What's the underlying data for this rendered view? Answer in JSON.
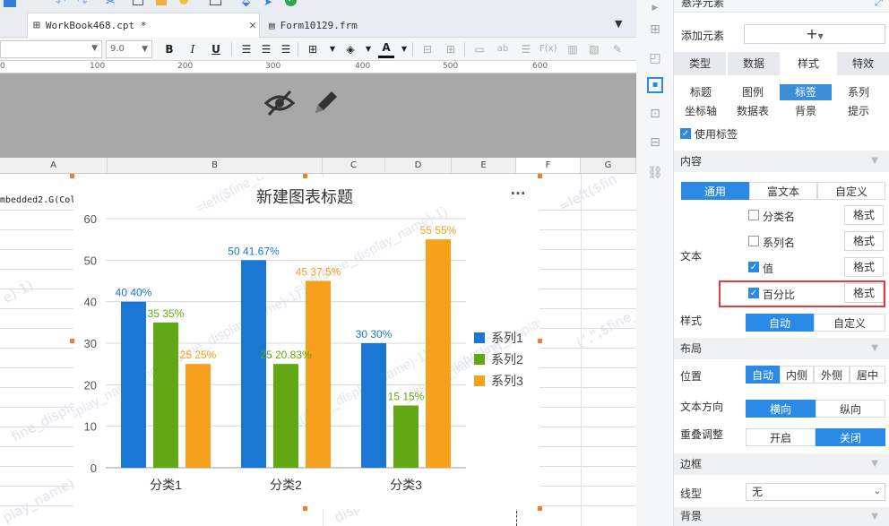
{
  "tabs": [
    {
      "label": "WorkBook468.cpt *"
    },
    {
      "label": "Form10129.frm"
    }
  ],
  "formatbar": {
    "font_size": "9.0",
    "bold": "B",
    "italic": "I",
    "underline": "U"
  },
  "ruler": {
    "ticks": [
      "0",
      "100",
      "200",
      "300",
      "400",
      "500",
      "600"
    ]
  },
  "sheet": {
    "columns": [
      "A",
      "B",
      "C",
      "D",
      "E",
      "F",
      "G"
    ],
    "cell_a1": "mbedded2.G(Col",
    "watermarks": [
      "=left($fine_d",
      "=left($fine_display_name)-1)",
      "e)-1)",
      "fine_display_name,find(\",\",$fine_display_name)-1)",
      "=left($fine_display_name)-1)",
      "_display_name)-1)",
      "=left($fine_display_name)-1)",
      "play_name)-1)",
      "display_name)-1)",
      "(\",\",$fine_disp",
      "=left($fin"
    ]
  },
  "chart_data": {
    "type": "bar",
    "title": "新建图表标题",
    "categories": [
      "分类1",
      "分类2",
      "分类3"
    ],
    "ylim": [
      0,
      60
    ],
    "yticks": [
      0,
      10,
      20,
      30,
      40,
      50,
      60
    ],
    "grid": true,
    "legend_position": "right",
    "series": [
      {
        "name": "系列1",
        "color": "#1a78d4",
        "values": [
          40,
          50,
          30
        ],
        "labels": [
          "40  40%",
          "50  41.67%",
          "30  30%"
        ]
      },
      {
        "name": "系列2",
        "color": "#62a814",
        "values": [
          35,
          25,
          15
        ],
        "labels": [
          "35  35%",
          "25  20.83%",
          "15  15%"
        ]
      },
      {
        "name": "系列3",
        "color": "#f7a01c",
        "values": [
          25,
          45,
          55
        ],
        "labels": [
          "25  25%",
          "45  37.5%",
          "55  55%"
        ]
      }
    ],
    "more_icon": "..."
  },
  "panel": {
    "header": "悬浮元素",
    "add_element_label": "添加元素",
    "add_button": "+",
    "main_tabs": [
      "类型",
      "数据",
      "样式",
      "特效"
    ],
    "main_tab_active": "样式",
    "sub_tabs": [
      "标题",
      "图例",
      "标签",
      "系列",
      "坐标轴",
      "数据表",
      "背景",
      "提示"
    ],
    "sub_tab_active": "标签",
    "use_label": "使用标签",
    "content_section": "内容",
    "content_modes": [
      "通用",
      "富文本",
      "自定义"
    ],
    "text_label": "文本",
    "text_options": [
      {
        "label": "分类名",
        "checked": false,
        "btn": "格式"
      },
      {
        "label": "系列名",
        "checked": false,
        "btn": "格式"
      },
      {
        "label": "值",
        "checked": true,
        "btn": "格式"
      },
      {
        "label": "百分比",
        "checked": true,
        "btn": "格式"
      }
    ],
    "style_label": "样式",
    "style_modes": [
      "自动",
      "自定义"
    ],
    "layout_section": "布局",
    "position_label": "位置",
    "position_modes": [
      "自动",
      "内侧",
      "外侧",
      "居中"
    ],
    "text_dir_label": "文本方向",
    "text_dir_modes": [
      "横向",
      "纵向"
    ],
    "overlap_label": "重叠调整",
    "overlap_modes": [
      "开启",
      "关闭"
    ],
    "border_section": "边框",
    "linetype_label": "线型",
    "linetype_value": "无",
    "bg_section": "背景",
    "highlight_color": "#e03c3c"
  }
}
